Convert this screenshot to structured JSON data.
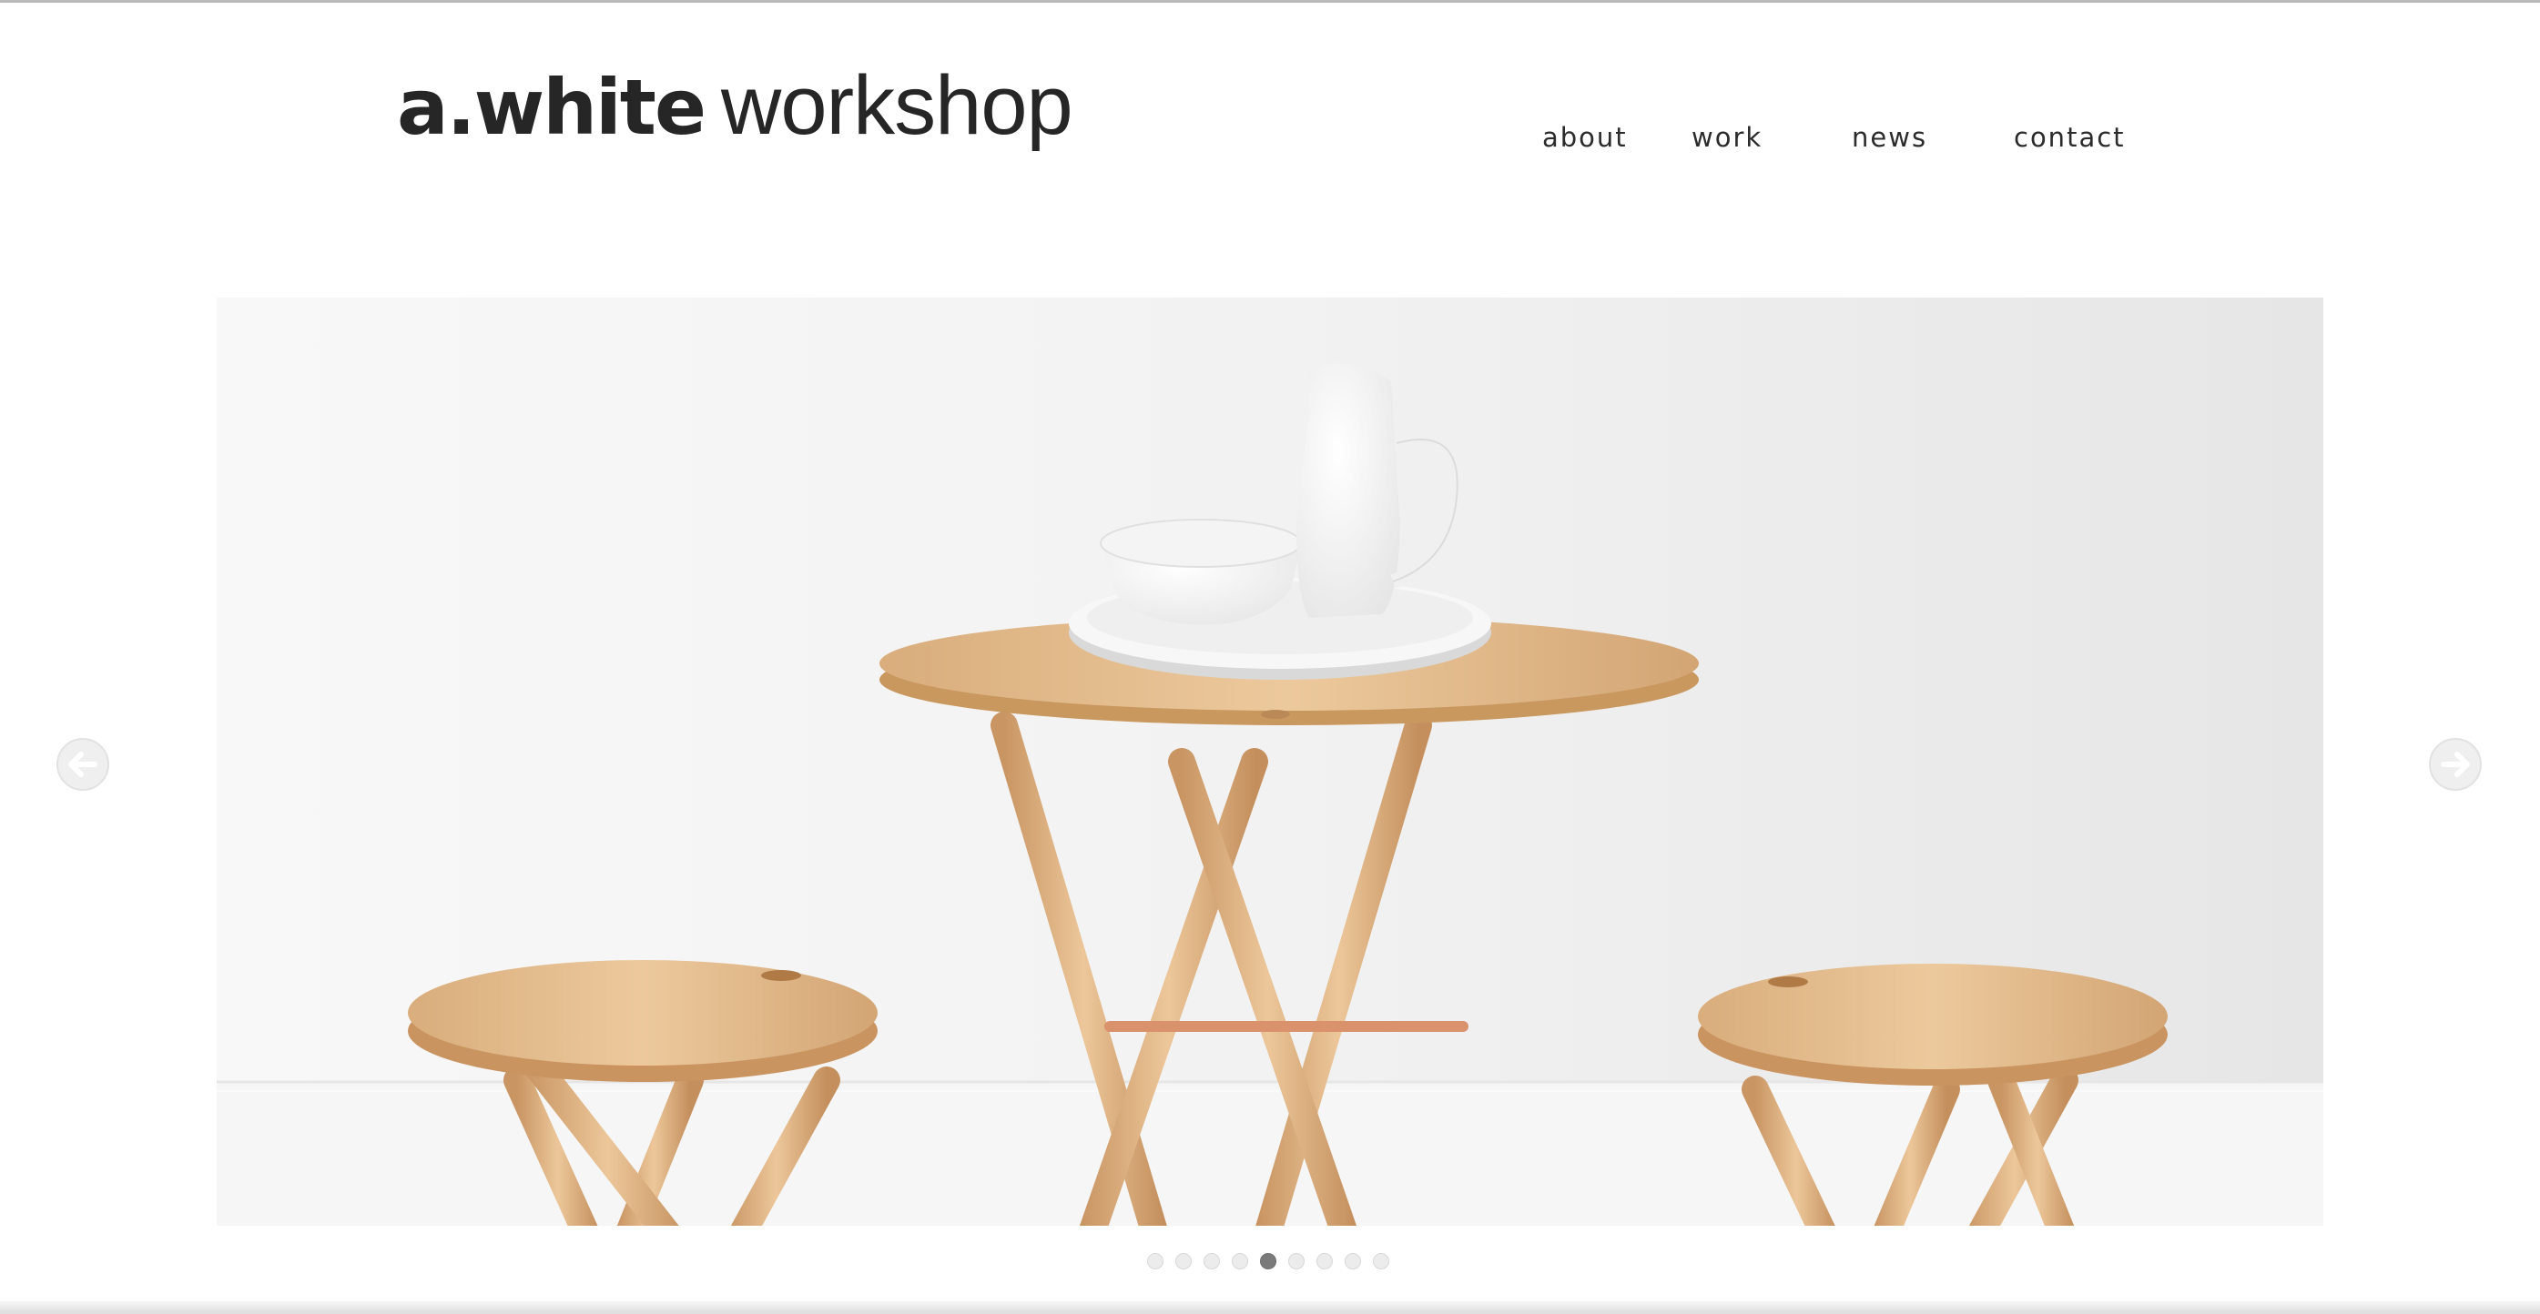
{
  "logo": {
    "bold": "a.white",
    "light": "workshop"
  },
  "nav": [
    {
      "label": "about"
    },
    {
      "label": "work"
    },
    {
      "label": "news"
    },
    {
      "label": "contact"
    }
  ],
  "slider": {
    "image_alt": "Round wooden table with white pitcher, bowl and tray between two wooden stools",
    "dot_count": 9,
    "active_index": 4
  },
  "colors": {
    "text": "#262626",
    "wood": "#e0b78a",
    "background": "#ffffff"
  },
  "icons": {
    "prev": "arrow-left-icon",
    "next": "arrow-right-icon"
  }
}
